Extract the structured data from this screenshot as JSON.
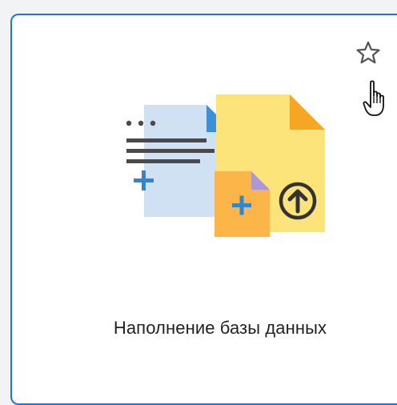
{
  "card": {
    "title": "Наполнение базы данных",
    "illustration_icon": "database-fill-illustration",
    "favorite_icon": "star-outline-icon",
    "cursor_icon": "hand-pointer-cursor"
  },
  "colors": {
    "border": "#1a73e8",
    "doc_blue": "#cfe1f3",
    "doc_blue_fold": "#3d8fd6",
    "doc_yellow": "#fde47a",
    "doc_yellow_fold": "#f6a623",
    "doc_orange": "#fbb548",
    "doc_orange_fold": "#a999d6",
    "lines": "#4a4a4a",
    "plus": "#2f86d1"
  }
}
